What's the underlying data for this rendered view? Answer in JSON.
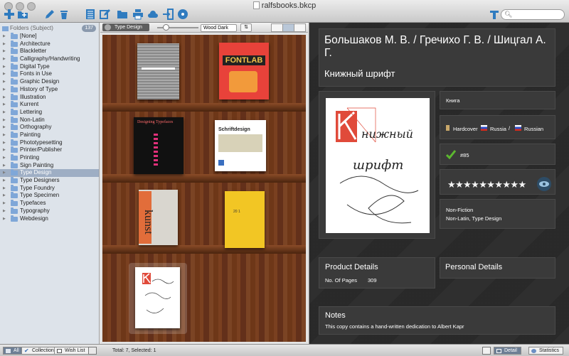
{
  "window": {
    "title": "ralfsbooks.bkcp"
  },
  "toolbar": {
    "buttons": [
      "add-icon",
      "add-folder-icon",
      "edit-icon",
      "trash-icon",
      "list-icon",
      "edit-list-icon",
      "folder-icon",
      "print-icon",
      "cloud-icon",
      "export-icon",
      "disc-icon"
    ],
    "search_placeholder": ""
  },
  "sidebar": {
    "header": "Folders (Subject)",
    "count": "137",
    "items": [
      {
        "label": "[None]"
      },
      {
        "label": "Architecture"
      },
      {
        "label": "Blackletter"
      },
      {
        "label": "Calligraphy/Handwriting"
      },
      {
        "label": "Digital Type"
      },
      {
        "label": "Fonts in Use"
      },
      {
        "label": "Graphic Design"
      },
      {
        "label": "History of Type"
      },
      {
        "label": "Illustration"
      },
      {
        "label": "Kurrent"
      },
      {
        "label": "Lettering"
      },
      {
        "label": "Non-Latin"
      },
      {
        "label": "Orthography"
      },
      {
        "label": "Painting"
      },
      {
        "label": "Phototypesetting"
      },
      {
        "label": "Printer/Publisher"
      },
      {
        "label": "Printing"
      },
      {
        "label": "Sign Painting"
      },
      {
        "label": "Type Design"
      },
      {
        "label": "Type Designers"
      },
      {
        "label": "Type Foundry"
      },
      {
        "label": "Type Specimen"
      },
      {
        "label": "Typefaces"
      },
      {
        "label": "Typography"
      },
      {
        "label": "Webdesign"
      }
    ],
    "selected_index": 18
  },
  "shelf_bar": {
    "breadcrumb": "Type Design",
    "theme": "Wood Dark"
  },
  "books": [
    {
      "name": "book-1",
      "cover_text": ""
    },
    {
      "name": "book-2",
      "cover_text": "FONTLAB"
    },
    {
      "name": "book-3",
      "cover_text": "Designing Typefaces"
    },
    {
      "name": "book-4",
      "cover_text": "Schriftdesign"
    },
    {
      "name": "book-5",
      "cover_text": "kunst"
    },
    {
      "name": "book-6",
      "cover_text": "20 1"
    },
    {
      "name": "book-7",
      "cover_text": ""
    }
  ],
  "detail": {
    "authors": "Большаков М. В. / Гречихо Г. В. / Шицгал А. Г.",
    "title": "Книжный шрифт",
    "format": "Книга",
    "binding": "Hardcover",
    "language_1": "Russia",
    "separator": "/",
    "language_2": "Russian",
    "number": "#85",
    "rating_stars": "★★★★★★★★★★",
    "rating": 10,
    "genre": "Non-Fiction",
    "subjects": "Non-Latin, Type Design",
    "product_details_title": "Product Details",
    "pages_label": "No. Of Pages",
    "pages_value": "309",
    "personal_details_title": "Personal Details",
    "notes_title": "Notes",
    "notes_text": "This copy contains a hand-written dedication to Albert Kapr"
  },
  "bottom": {
    "filter_all": "All",
    "filter_collection": "Collection",
    "filter_wishlist": "Wish List",
    "status": "Total: 7, Selected: 1",
    "tab_detail": "Detail",
    "tab_statistics": "Statistics"
  },
  "colors": {
    "accent": "#6e7f95",
    "selection": "#9eaec4",
    "panel": "#3a3a3a",
    "check": "#5cb82f"
  }
}
